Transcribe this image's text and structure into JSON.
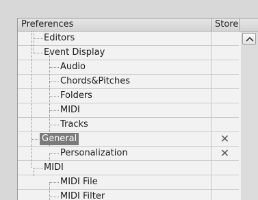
{
  "header": {
    "preferences": "Preferences",
    "store": "Store"
  },
  "tree": [
    {
      "label": "Editors",
      "store": ""
    },
    {
      "label": "Event Display",
      "store": ""
    },
    {
      "label": "Audio",
      "store": ""
    },
    {
      "label": "Chords&Pitches",
      "store": ""
    },
    {
      "label": "Folders",
      "store": ""
    },
    {
      "label": "MIDI",
      "store": ""
    },
    {
      "label": "Tracks",
      "store": ""
    },
    {
      "label": "General",
      "store": "✕",
      "selected": true
    },
    {
      "label": "Personalization",
      "store": "✕"
    },
    {
      "label": "MIDI",
      "store": ""
    },
    {
      "label": "MIDI File",
      "store": ""
    },
    {
      "label": "MIDI Filter",
      "store": ""
    }
  ],
  "icons": {
    "scroll_up": "chevron-up-icon",
    "stored": "x-mark-icon"
  },
  "colors": {
    "selection": "#7b7b7b",
    "background": "#f2f2f2"
  }
}
